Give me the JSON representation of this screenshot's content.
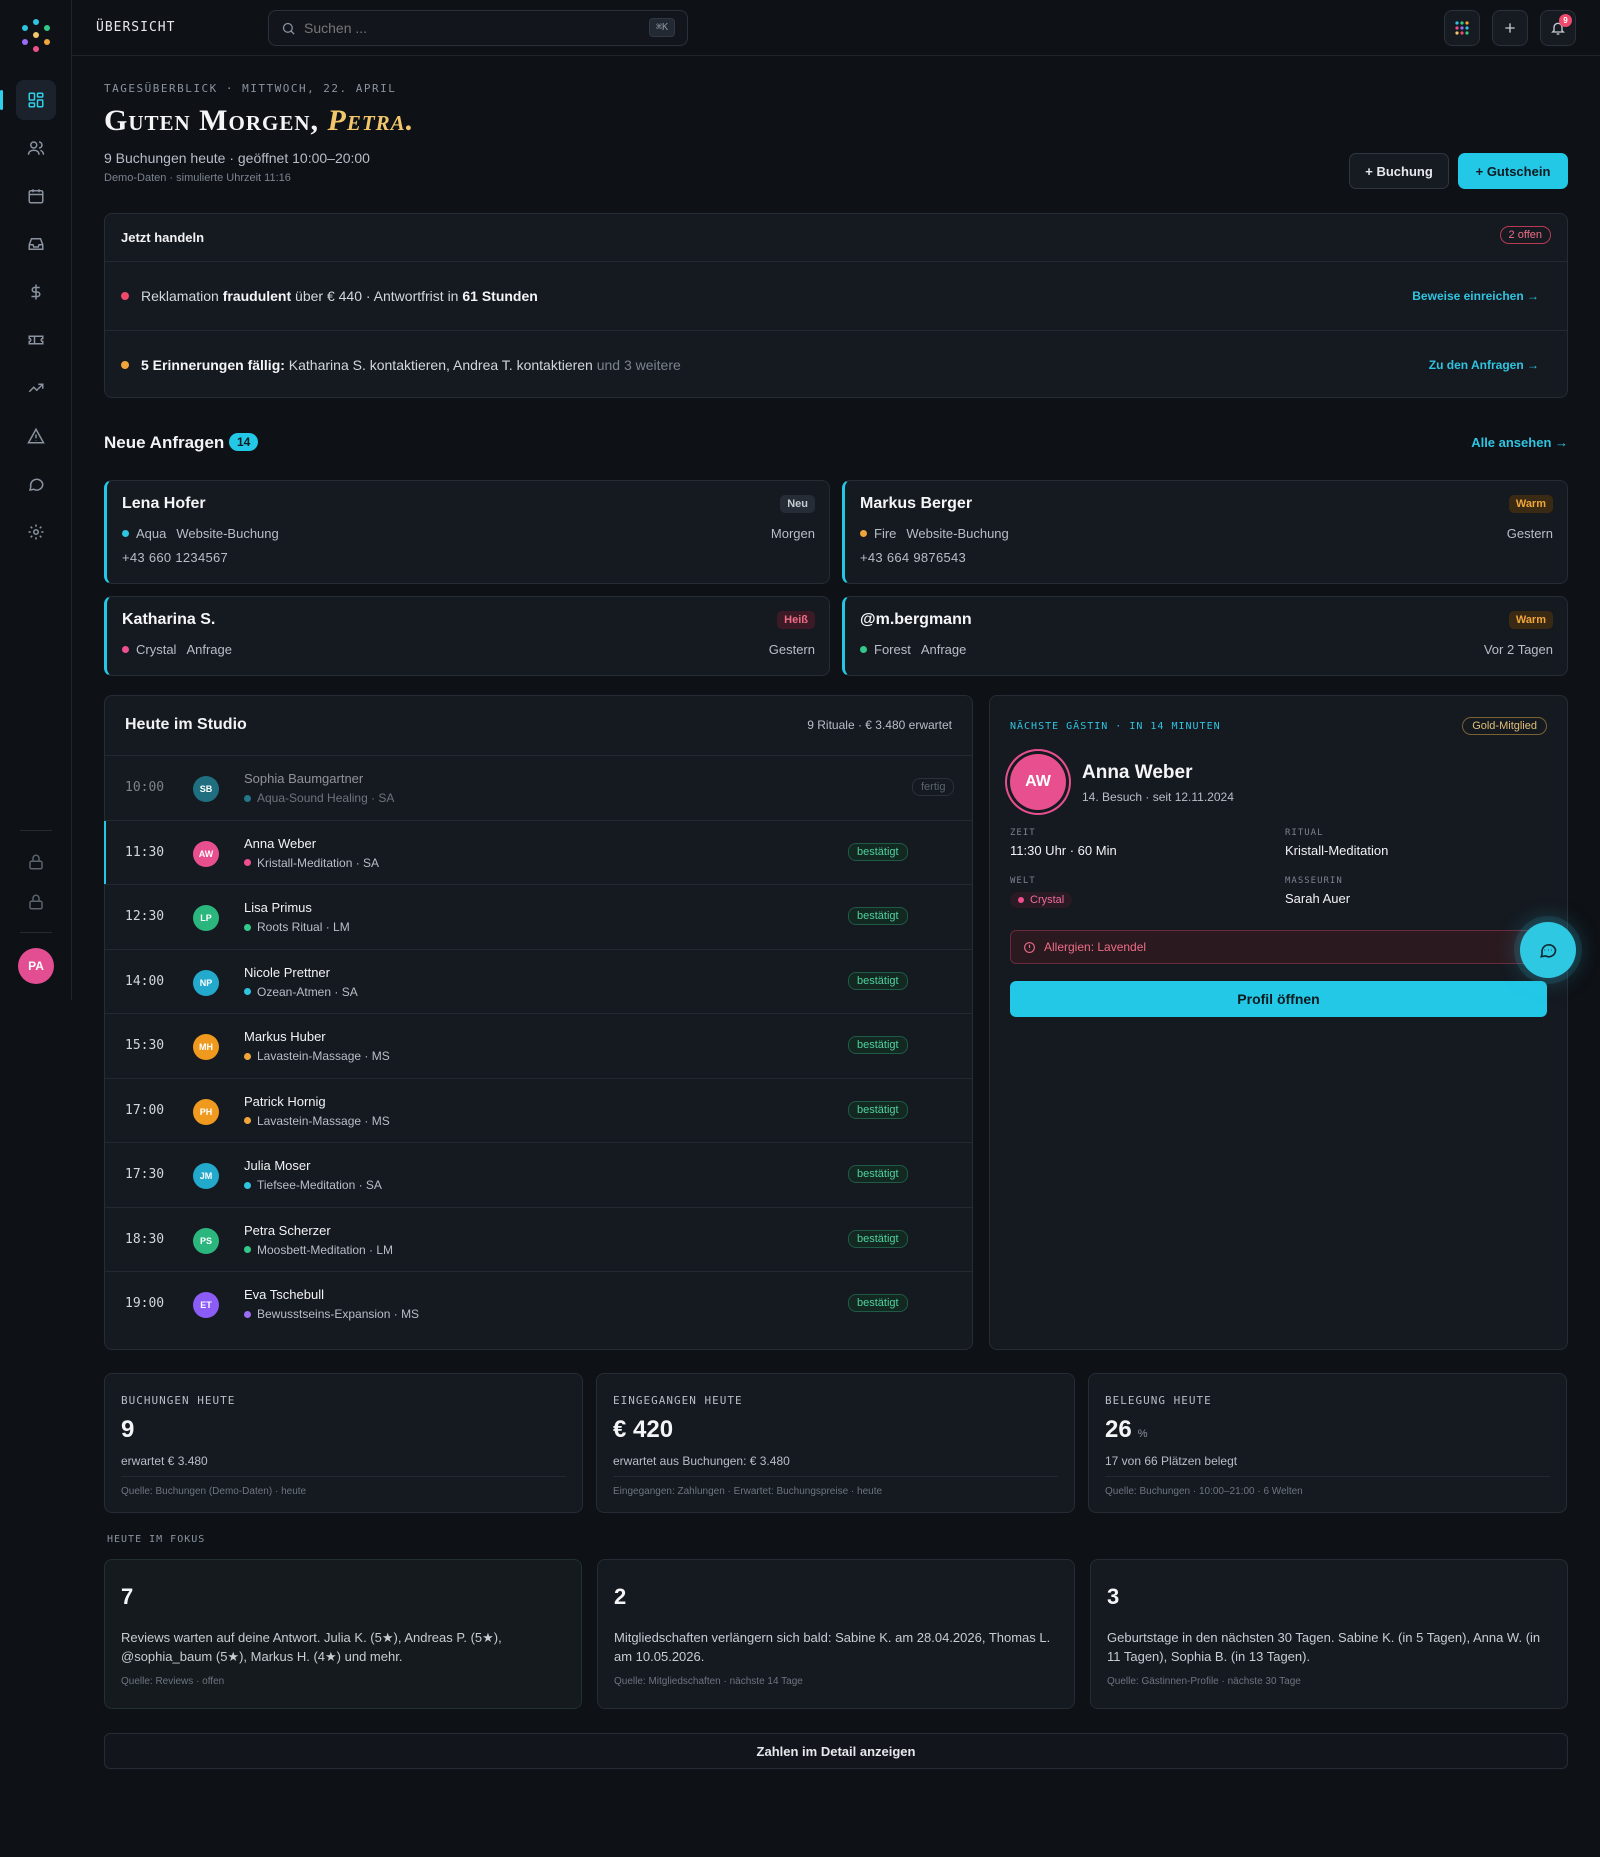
{
  "topbar": {
    "title": "ÜBERSICHT",
    "search_placeholder": "Suchen ...",
    "search_shortcut": "⌘K",
    "notification_count": "9"
  },
  "header": {
    "eyebrow": "TAGESÜBERBLICK · MITTWOCH, 22. APRIL",
    "greeting": "Guten Morgen,",
    "greeting_name": "Petra.",
    "summary": "9 Buchungen heute · geöffnet 10:00–20:00",
    "note": "Demo-Daten · simulierte Uhrzeit 11:16",
    "btn_booking": "+ Buchung",
    "btn_voucher": "+ Gutschein"
  },
  "actions": {
    "title": "Jetzt handeln",
    "open_badge": "2 offen",
    "items": [
      {
        "pre": "Reklamation ",
        "bold1": "fraudulent",
        "mid": " über € 440 · Antwortfrist in ",
        "bold2": "61 Stunden",
        "post": "",
        "link": "Beweise einreichen →",
        "color": "#ef4a6c"
      },
      {
        "pre": "",
        "bold1": "5 Erinnerungen fällig:",
        "mid": " Katharina S. kontaktieren, Andrea T. kontaktieren ",
        "bold2": "",
        "post": "und 3 weitere",
        "link": "Zu den Anfragen →",
        "color": "#f0a53a"
      }
    ]
  },
  "requests": {
    "title": "Neue Anfragen",
    "count": "14",
    "see_all": "Alle ansehen →",
    "cards": [
      {
        "name": "Lena Hofer",
        "tag": "Neu",
        "world": "Aqua",
        "world_color": "#2fc4e0",
        "source": "Website-Buchung",
        "when": "Morgen",
        "phone": "+43 660 1234567"
      },
      {
        "name": "Markus Berger",
        "tag": "Warm",
        "world": "Fire",
        "world_color": "#f0a53a",
        "source": "Website-Buchung",
        "when": "Gestern",
        "phone": "+43 664 9876543"
      },
      {
        "name": "Katharina S.",
        "tag": "Heiß",
        "world": "Crystal",
        "world_color": "#ef4f8f",
        "source": "Anfrage",
        "when": "Gestern",
        "phone": ""
      },
      {
        "name": "@m.bergmann",
        "tag": "Warm",
        "world": "Forest",
        "world_color": "#34c98a",
        "source": "Anfrage",
        "when": "Vor 2 Tagen",
        "phone": ""
      }
    ]
  },
  "schedule": {
    "title": "Heute im Studio",
    "summary": "9 Rituale · € 3.480 erwartet",
    "rows": [
      {
        "time": "10:00",
        "initials": "SB",
        "av_color": "#1f6f80",
        "name": "Sophia Baumgartner",
        "ritual": "Aqua-Sound Healing · SA",
        "dot": "#2fc4e0",
        "status": "fertig",
        "state": "done"
      },
      {
        "time": "11:30",
        "initials": "AW",
        "av_color": "#e84f8f",
        "name": "Anna Weber",
        "ritual": "Kristall-Meditation · SA",
        "dot": "#ef4f8f",
        "status": "bestätigt",
        "state": "current"
      },
      {
        "time": "12:30",
        "initials": "LP",
        "av_color": "#2bb67e",
        "name": "Lisa Primus",
        "ritual": "Roots Ritual · LM",
        "dot": "#34c98a",
        "status": "bestätigt",
        "state": ""
      },
      {
        "time": "14:00",
        "initials": "NP",
        "av_color": "#23a9cc",
        "name": "Nicole Prettner",
        "ritual": "Ozean-Atmen · SA",
        "dot": "#2fc4e0",
        "status": "bestätigt",
        "state": ""
      },
      {
        "time": "15:30",
        "initials": "MH",
        "av_color": "#ef9a1f",
        "name": "Markus Huber",
        "ritual": "Lavastein-Massage · MS",
        "dot": "#f0a53a",
        "status": "bestätigt",
        "state": ""
      },
      {
        "time": "17:00",
        "initials": "PH",
        "av_color": "#ef9a1f",
        "name": "Patrick Hornig",
        "ritual": "Lavastein-Massage · MS",
        "dot": "#f0a53a",
        "status": "bestätigt",
        "state": ""
      },
      {
        "time": "17:30",
        "initials": "JM",
        "av_color": "#23a9cc",
        "name": "Julia Moser",
        "ritual": "Tiefsee-Meditation · SA",
        "dot": "#2fc4e0",
        "status": "bestätigt",
        "state": ""
      },
      {
        "time": "18:30",
        "initials": "PS",
        "av_color": "#2bb67e",
        "name": "Petra Scherzer",
        "ritual": "Moosbett-Meditation · LM",
        "dot": "#34c98a",
        "status": "bestätigt",
        "state": ""
      },
      {
        "time": "19:00",
        "initials": "ET",
        "av_color": "#8b5cf6",
        "name": "Eva Tschebull",
        "ritual": "Bewusstseins-Expansion · MS",
        "dot": "#9b6cf6",
        "status": "bestätigt",
        "state": ""
      }
    ]
  },
  "next_guest": {
    "eyebrow": "NÄCHSTE GÄSTIN · IN 14 MINUTEN",
    "membership": "Gold-Mitglied",
    "initials": "AW",
    "name": "Anna Weber",
    "visits": "14. Besuch · seit 12.11.2024",
    "time_label": "ZEIT",
    "time": "11:30 Uhr · 60 Min",
    "ritual_label": "RITUAL",
    "ritual": "Kristall-Meditation",
    "world_label": "WELT",
    "world": "Crystal",
    "masseuse_label": "MASSEURIN",
    "masseuse": "Sarah Auer",
    "allergy": "Allergien: Lavendel",
    "profile_btn": "Profil öffnen"
  },
  "kpis": [
    {
      "label": "BUCHUNGEN HEUTE",
      "value": "9",
      "unit": "",
      "sub": "erwartet € 3.480",
      "src": "Quelle: Buchungen (Demo-Daten) · heute"
    },
    {
      "label": "EINGEGANGEN HEUTE",
      "value": "€ 420",
      "unit": "",
      "sub": "erwartet aus Buchungen: € 3.480",
      "src": "Eingegangen: Zahlungen · Erwartet: Buchungspreise · heute"
    },
    {
      "label": "BELEGUNG HEUTE",
      "value": "26",
      "unit": "%",
      "sub": "17 von 66 Plätzen belegt",
      "src": "Quelle: Buchungen · 10:00–21:00 · 6 Welten"
    }
  ],
  "focus": {
    "title": "HEUTE IM FOKUS",
    "cards": [
      {
        "num": "7",
        "text": "Reviews warten auf deine Antwort. Julia K. (5★), Andreas P. (5★), @sophia_baum (5★), Markus H. (4★) und mehr.",
        "src": "Quelle: Reviews · offen"
      },
      {
        "num": "2",
        "text": "Mitgliedschaften verlängern sich bald: Sabine K. am 28.04.2026, Thomas L. am 10.05.2026.",
        "src": "Quelle: Mitgliedschaften · nächste 14 Tage"
      },
      {
        "num": "3",
        "text": "Geburtstage in den nächsten 30 Tagen. Sabine K. (in 5 Tagen), Anna W. (in 11 Tagen), Sophia B. (in 13 Tagen).",
        "src": "Quelle: Gästinnen-Profile · nächste 30 Tage"
      }
    ]
  },
  "detail_btn": "Zahlen im Detail anzeigen",
  "user_initials": "PA",
  "colors": {
    "accent": "#22c8e6",
    "bg": "#0e1116",
    "panel": "#151920",
    "gold": "#f2c76b"
  }
}
